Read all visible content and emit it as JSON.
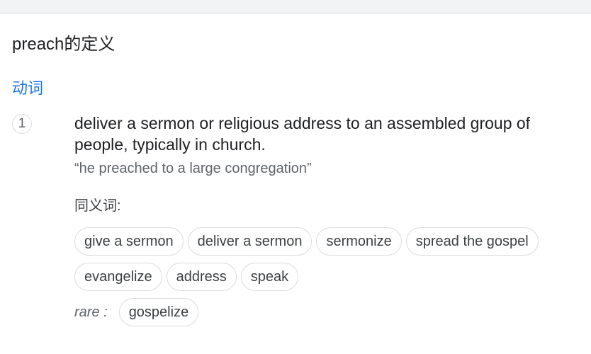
{
  "heading": "preach的定义",
  "part_of_speech": "动词",
  "senses": [
    {
      "number": "1",
      "definition": "deliver a sermon or religious address to an assembled group of people, typically in church.",
      "example": "“he preached to a large congregation”",
      "synonyms_label": "同义词:",
      "synonyms": [
        "give a sermon",
        "deliver a sermon",
        "sermonize",
        "spread the gospel",
        "evangelize",
        "address",
        "speak"
      ],
      "rare_label": "rare :",
      "rare_synonyms": [
        "gospelize"
      ]
    }
  ],
  "colors": {
    "accent": "#1a73e8",
    "text": "#202124",
    "muted": "#5f6368",
    "chip_border": "#dadce0"
  }
}
